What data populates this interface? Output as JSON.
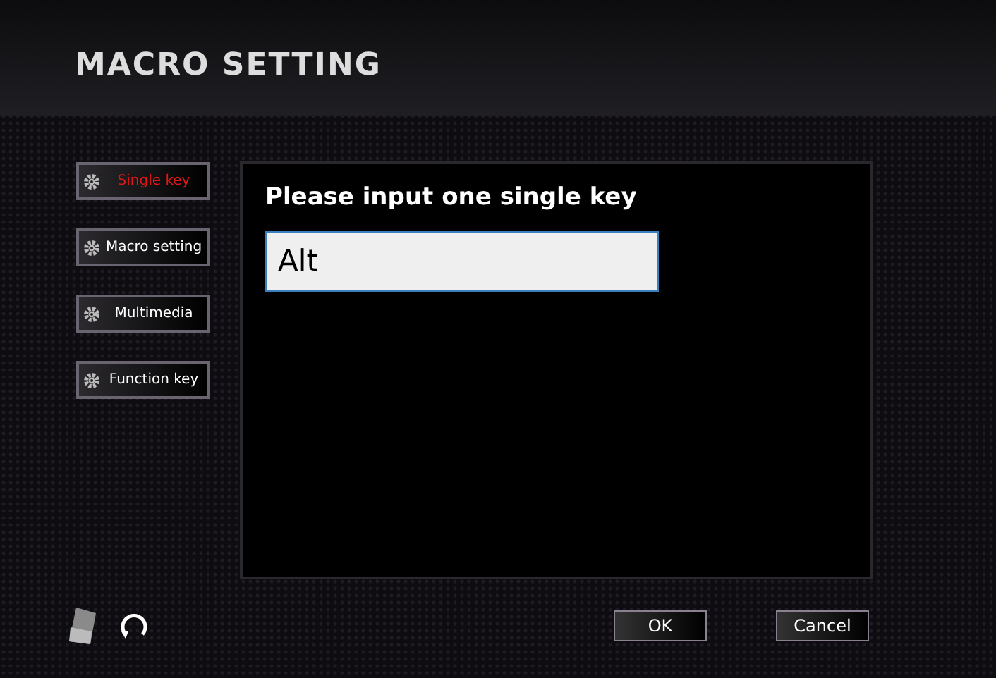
{
  "window": {
    "title": "MACRO SETTING"
  },
  "sidebar": {
    "items": [
      {
        "label": "Single key",
        "selected": true
      },
      {
        "label": "Macro setting",
        "selected": false
      },
      {
        "label": "Multimedia",
        "selected": false
      },
      {
        "label": "Function key",
        "selected": false
      }
    ]
  },
  "panel": {
    "heading": "Please input one single key",
    "input": {
      "value": "Alt"
    }
  },
  "buttons": [
    "OK",
    "Cancel"
  ]
}
